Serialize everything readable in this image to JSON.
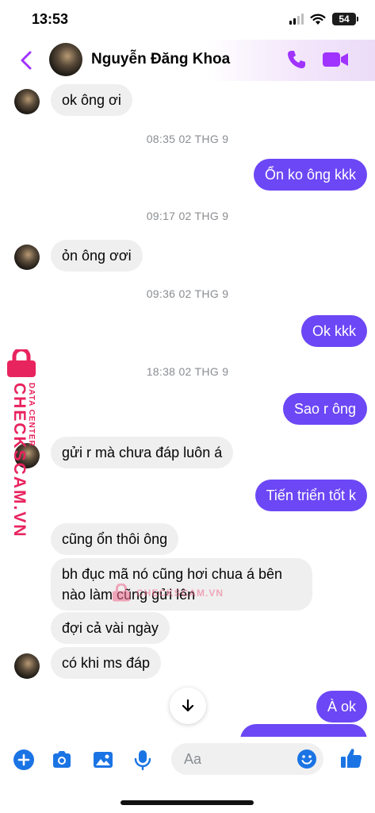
{
  "status_bar": {
    "time": "13:53",
    "battery": "54"
  },
  "header": {
    "contact_name": "Nguyễn Đăng Khoa"
  },
  "messages": [
    {
      "text": "ok ông ơi"
    },
    {
      "timestamp": "08:35 02 THG 9"
    },
    {
      "text": "Ổn ko ông kkk"
    },
    {
      "timestamp": "09:17 02 THG 9"
    },
    {
      "text": "ỏn ông ơơi"
    },
    {
      "timestamp": "09:36 02 THG 9"
    },
    {
      "text": "Ok kkk"
    },
    {
      "timestamp": "18:38 02 THG 9"
    },
    {
      "text": "Sao r ông"
    },
    {
      "text": "gửi r mà chưa đáp luôn  á"
    },
    {
      "text": "Tiến triển tốt k"
    },
    {
      "text": "cũng ổn thôi ông"
    },
    {
      "text": "bh đục mã nó cũng hơi chua á bên nào làm cũng gửi lên"
    },
    {
      "text": "đợi cả vài ngày"
    },
    {
      "text": "có khi ms đáp"
    },
    {
      "text": "À ok"
    }
  ],
  "watermark": {
    "brand": "CHECKSCAM.VN",
    "sub": "DATA CENTER",
    "center": "CHECKSCAM.VN"
  },
  "composer": {
    "placeholder": "Aa"
  },
  "colors": {
    "accent": "#6c47f5",
    "header_icons": "#a033ff",
    "incoming_bubble": "#efefef",
    "watermark": "#e8245f"
  }
}
